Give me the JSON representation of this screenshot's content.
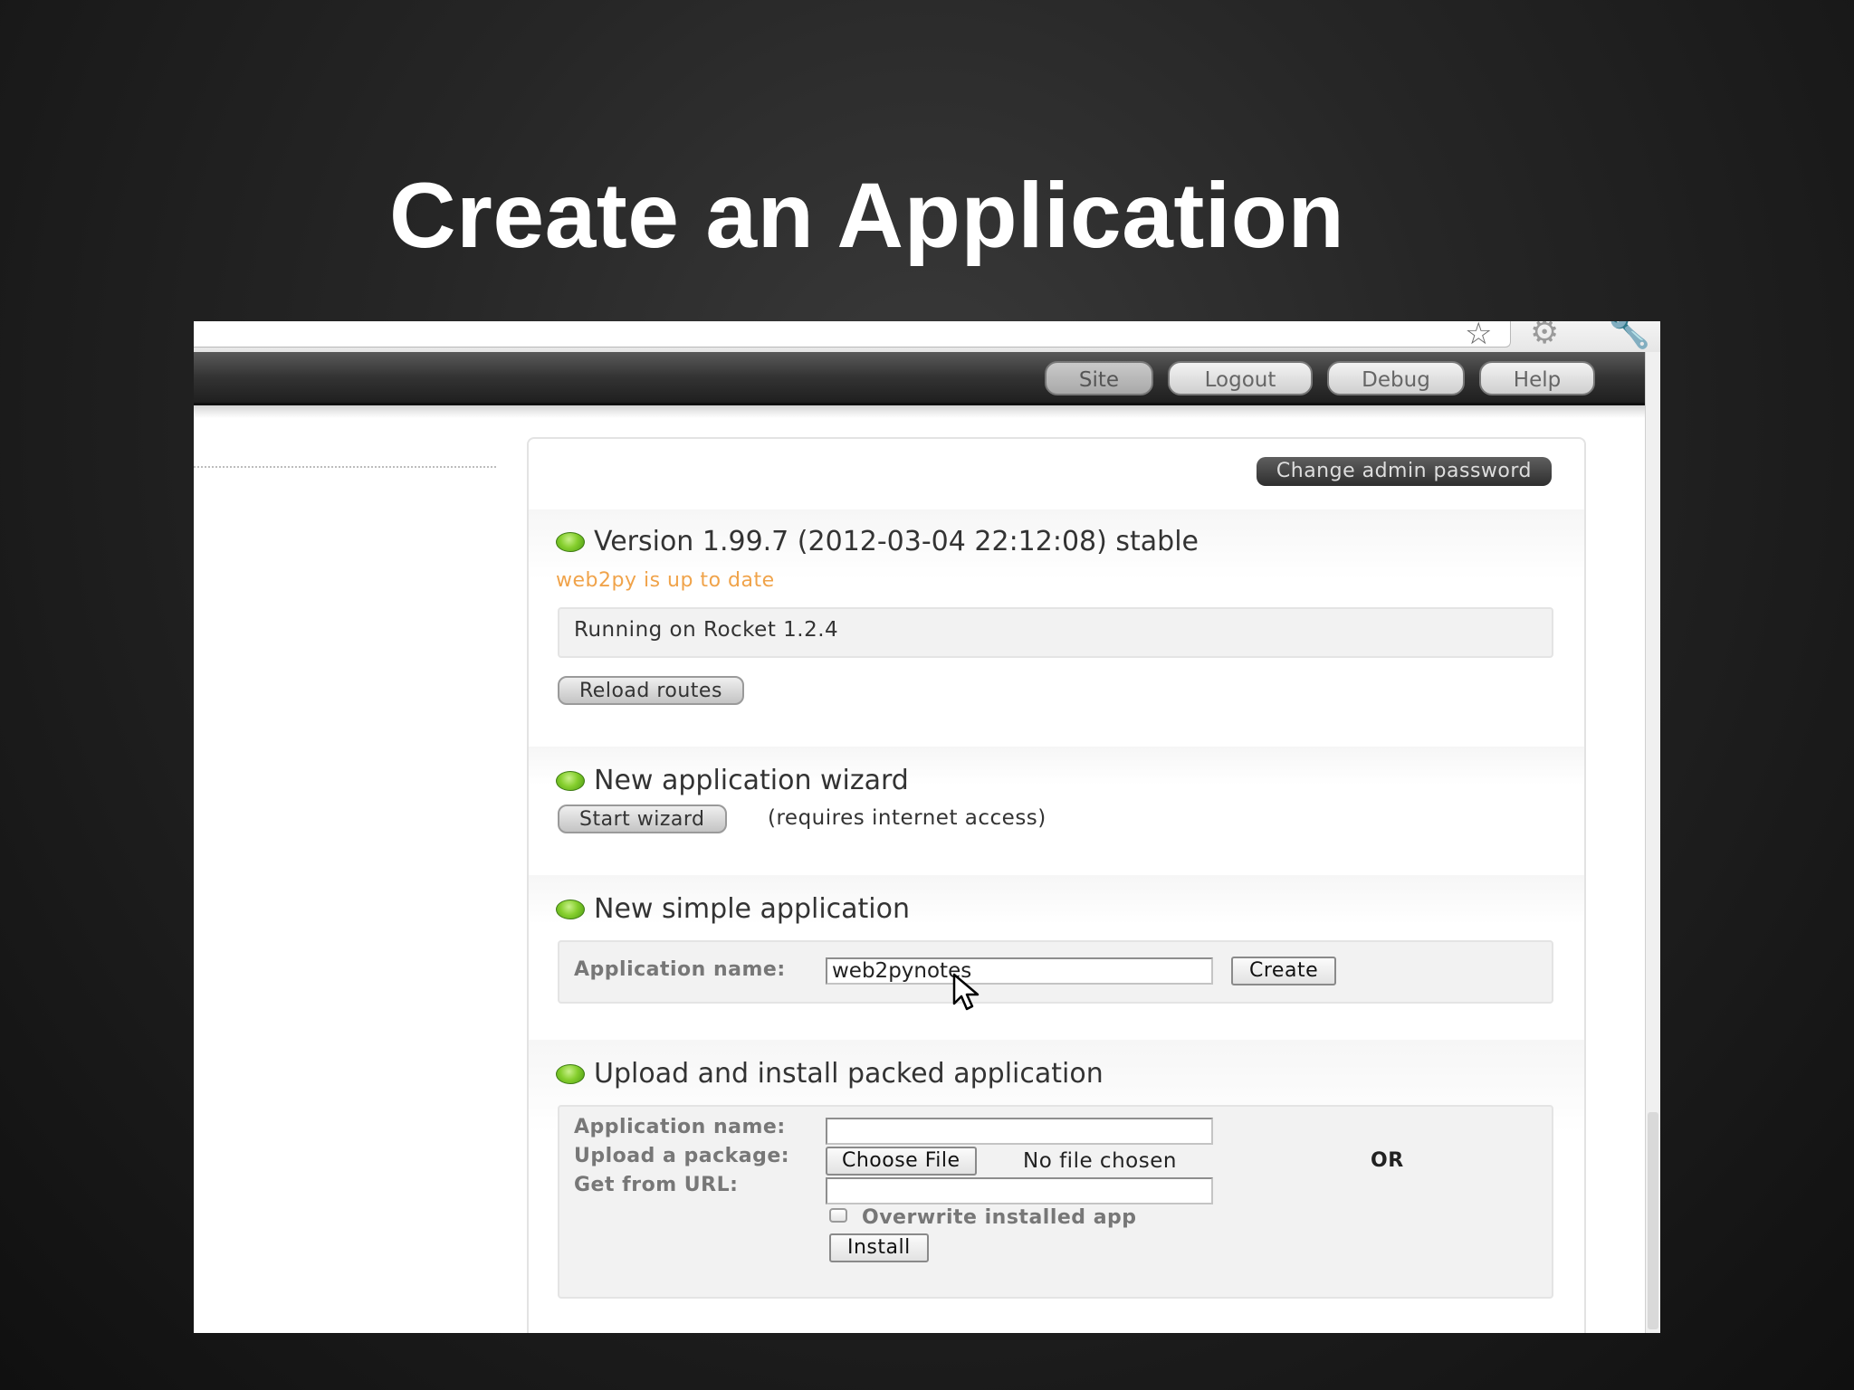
{
  "slide": {
    "title": "Create an Application"
  },
  "nav": {
    "items": [
      {
        "label": "Site",
        "active": true
      },
      {
        "label": "Logout"
      },
      {
        "label": "Debug"
      },
      {
        "label": "Help"
      }
    ]
  },
  "admin": {
    "change_password_label": "Change admin password"
  },
  "version": {
    "heading": "Version 1.99.7 (2012-03-04 22:12:08) stable",
    "status": "web2py is up to date",
    "server": "Running on Rocket 1.2.4",
    "reload_label": "Reload routes"
  },
  "wizard": {
    "heading": "New application wizard",
    "start_label": "Start wizard",
    "note": "(requires internet access)"
  },
  "simple_app": {
    "heading": "New simple application",
    "name_label": "Application name:",
    "name_value": "web2pynotes",
    "create_label": "Create"
  },
  "upload": {
    "heading": "Upload and install packed application",
    "name_label": "Application name:",
    "package_label": "Upload a package:",
    "url_label": "Get from URL:",
    "choose_file_label": "Choose File",
    "no_file_text": "No file chosen",
    "or_text": "OR",
    "overwrite_label": "Overwrite installed app",
    "install_label": "Install"
  },
  "colors": {
    "status_dot": "#86cf2e",
    "status_text": "#f0a34a",
    "navbar": "#333333"
  }
}
